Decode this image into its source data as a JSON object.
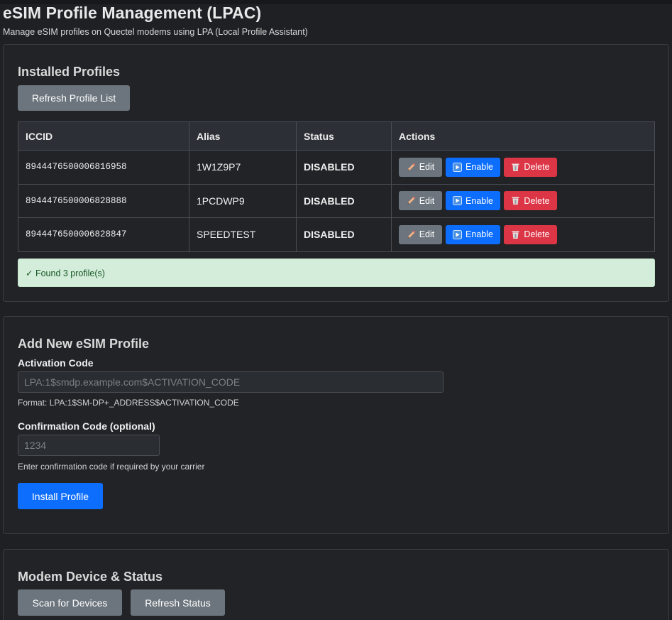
{
  "page": {
    "title": "eSIM Profile Management (LPAC)",
    "subtitle": "Manage eSIM profiles on Quectel modems using LPA (Local Profile Assistant)"
  },
  "installed": {
    "heading": "Installed Profiles",
    "refresh_label": "Refresh Profile List",
    "columns": [
      "ICCID",
      "Alias",
      "Status",
      "Actions"
    ],
    "rows": [
      {
        "iccid": "8944476500006816958",
        "alias": "1W1Z9P7",
        "status": "DISABLED"
      },
      {
        "iccid": "8944476500006828888",
        "alias": "1PCDWP9",
        "status": "DISABLED"
      },
      {
        "iccid": "8944476500006828847",
        "alias": "SPEEDTEST",
        "status": "DISABLED"
      }
    ],
    "actions": {
      "edit": "Edit",
      "enable": "Enable",
      "delete": "Delete"
    },
    "alert": "✓ Found 3 profile(s)"
  },
  "add": {
    "heading": "Add New eSIM Profile",
    "activation_label": "Activation Code",
    "activation_placeholder": "LPA:1$smdp.example.com$ACTIVATION_CODE",
    "activation_help": "Format: LPA:1$SM-DP+_ADDRESS$ACTIVATION_CODE",
    "confirm_label": "Confirmation Code (optional)",
    "confirm_placeholder": "1234",
    "confirm_help": "Enter confirmation code if required by your carrier",
    "install_label": "Install Profile"
  },
  "modem": {
    "heading": "Modem Device & Status",
    "scan_label": "Scan for Devices",
    "refresh_label": "Refresh Status"
  },
  "colors": {
    "background": "#1e2024",
    "card": "#212327",
    "primary": "#0d6efd",
    "secondary": "#6c757d",
    "danger": "#dc3545",
    "status_disabled": "#f29a1f",
    "success_bg": "#d4edda"
  },
  "icons": {
    "edit": "pencil-icon",
    "enable": "play-icon",
    "delete": "trash-icon"
  }
}
